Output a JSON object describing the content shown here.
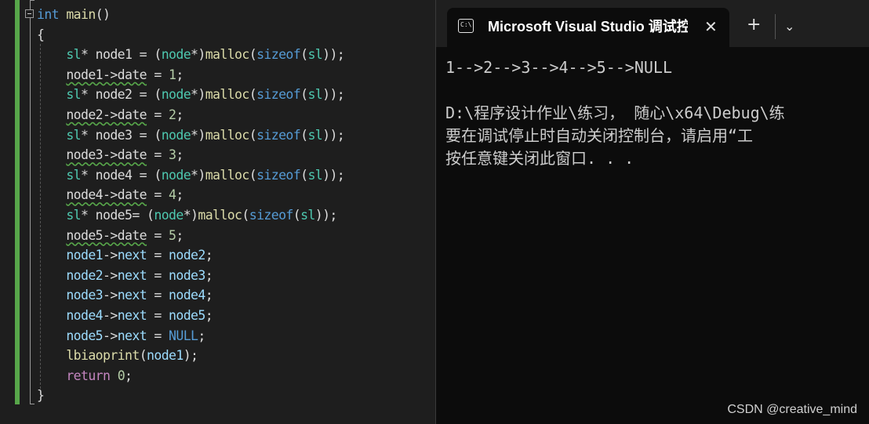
{
  "editor": {
    "lines": [
      {
        "parts": [
          [
            "int",
            "k"
          ],
          [
            " main",
            "f"
          ],
          [
            "()",
            ""
          ]
        ]
      },
      {
        "parts": [
          [
            "{",
            ""
          ]
        ]
      },
      {
        "parts": [
          [
            "    ",
            ""
          ],
          [
            "sl",
            "t"
          ],
          [
            "* node1 = (",
            ""
          ],
          [
            "node",
            "t"
          ],
          [
            "*)",
            ""
          ],
          [
            "malloc",
            "f"
          ],
          [
            "(",
            ""
          ],
          [
            "sizeof",
            "k"
          ],
          [
            "(",
            ""
          ],
          [
            "sl",
            "t"
          ],
          [
            "));",
            ""
          ]
        ]
      },
      {
        "parts": [
          [
            "    ",
            ""
          ],
          [
            "node1->date",
            "w"
          ],
          [
            " = ",
            ""
          ],
          [
            "1",
            "n"
          ],
          [
            ";",
            ""
          ]
        ]
      },
      {
        "parts": [
          [
            "    ",
            ""
          ],
          [
            "sl",
            "t"
          ],
          [
            "* node2 = (",
            ""
          ],
          [
            "node",
            "t"
          ],
          [
            "*)",
            ""
          ],
          [
            "malloc",
            "f"
          ],
          [
            "(",
            ""
          ],
          [
            "sizeof",
            "k"
          ],
          [
            "(",
            ""
          ],
          [
            "sl",
            "t"
          ],
          [
            "));",
            ""
          ]
        ]
      },
      {
        "parts": [
          [
            "    ",
            ""
          ],
          [
            "node2->date",
            "w"
          ],
          [
            " = ",
            ""
          ],
          [
            "2",
            "n"
          ],
          [
            ";",
            ""
          ]
        ]
      },
      {
        "parts": [
          [
            "    ",
            ""
          ],
          [
            "sl",
            "t"
          ],
          [
            "* node3 = (",
            ""
          ],
          [
            "node",
            "t"
          ],
          [
            "*)",
            ""
          ],
          [
            "malloc",
            "f"
          ],
          [
            "(",
            ""
          ],
          [
            "sizeof",
            "k"
          ],
          [
            "(",
            ""
          ],
          [
            "sl",
            "t"
          ],
          [
            "));",
            ""
          ]
        ]
      },
      {
        "parts": [
          [
            "    ",
            ""
          ],
          [
            "node3->date",
            "w"
          ],
          [
            " = ",
            ""
          ],
          [
            "3",
            "n"
          ],
          [
            ";",
            ""
          ]
        ]
      },
      {
        "parts": [
          [
            "    ",
            ""
          ],
          [
            "sl",
            "t"
          ],
          [
            "* node4 = (",
            ""
          ],
          [
            "node",
            "t"
          ],
          [
            "*)",
            ""
          ],
          [
            "malloc",
            "f"
          ],
          [
            "(",
            ""
          ],
          [
            "sizeof",
            "k"
          ],
          [
            "(",
            ""
          ],
          [
            "sl",
            "t"
          ],
          [
            "));",
            ""
          ]
        ]
      },
      {
        "parts": [
          [
            "    ",
            ""
          ],
          [
            "node4->date",
            "w"
          ],
          [
            " = ",
            ""
          ],
          [
            "4",
            "n"
          ],
          [
            ";",
            ""
          ]
        ]
      },
      {
        "parts": [
          [
            "    ",
            ""
          ],
          [
            "sl",
            "t"
          ],
          [
            "* node5= (",
            ""
          ],
          [
            "node",
            "t"
          ],
          [
            "*)",
            ""
          ],
          [
            "malloc",
            "f"
          ],
          [
            "(",
            ""
          ],
          [
            "sizeof",
            "k"
          ],
          [
            "(",
            ""
          ],
          [
            "sl",
            "t"
          ],
          [
            "));",
            ""
          ]
        ]
      },
      {
        "parts": [
          [
            "    ",
            ""
          ],
          [
            "node5->date",
            "w"
          ],
          [
            " = ",
            ""
          ],
          [
            "5",
            "n"
          ],
          [
            ";",
            ""
          ]
        ]
      },
      {
        "parts": [
          [
            "    ",
            ""
          ],
          [
            "node1",
            "v"
          ],
          [
            "->",
            ""
          ],
          [
            "next",
            "m"
          ],
          [
            " = ",
            ""
          ],
          [
            "node2",
            "v"
          ],
          [
            ";",
            ""
          ]
        ]
      },
      {
        "parts": [
          [
            "    ",
            ""
          ],
          [
            "node2",
            "v"
          ],
          [
            "->",
            ""
          ],
          [
            "next",
            "m"
          ],
          [
            " = ",
            ""
          ],
          [
            "node3",
            "v"
          ],
          [
            ";",
            ""
          ]
        ]
      },
      {
        "parts": [
          [
            "    ",
            ""
          ],
          [
            "node3",
            "v"
          ],
          [
            "->",
            ""
          ],
          [
            "next",
            "m"
          ],
          [
            " = ",
            ""
          ],
          [
            "node4",
            "v"
          ],
          [
            ";",
            ""
          ]
        ]
      },
      {
        "parts": [
          [
            "    ",
            ""
          ],
          [
            "node4",
            "v"
          ],
          [
            "->",
            ""
          ],
          [
            "next",
            "m"
          ],
          [
            " = ",
            ""
          ],
          [
            "node5",
            "v"
          ],
          [
            ";",
            ""
          ]
        ]
      },
      {
        "parts": [
          [
            "    ",
            ""
          ],
          [
            "node5",
            "v"
          ],
          [
            "->",
            ""
          ],
          [
            "next",
            "m"
          ],
          [
            " = ",
            ""
          ],
          [
            "NULL",
            "k"
          ],
          [
            ";",
            ""
          ]
        ]
      },
      {
        "parts": [
          [
            "    ",
            ""
          ],
          [
            "lbiaoprint",
            "f"
          ],
          [
            "(",
            ""
          ],
          [
            "node1",
            "v"
          ],
          [
            ");",
            ""
          ]
        ]
      },
      {
        "parts": [
          [
            "    ",
            ""
          ],
          [
            "return",
            "ret"
          ],
          [
            " ",
            ""
          ],
          [
            "0",
            "n"
          ],
          [
            ";",
            ""
          ]
        ]
      },
      {
        "parts": [
          [
            "}",
            ""
          ]
        ]
      }
    ]
  },
  "terminal": {
    "tab_title": "Microsoft Visual Studio 调试控制台",
    "tab_icon_text": "C:\\",
    "close_glyph": "✕",
    "new_tab_glyph": "+",
    "dropdown_glyph": "⌄",
    "output_lines": [
      "1-->2-->3-->4-->5-->NULL",
      "",
      "D:\\程序设计作业\\练习， 随心\\x64\\Debug\\练",
      "要在调试停止时自动关闭控制台，请启用“工",
      "按任意键关闭此窗口. . ."
    ]
  },
  "watermark": "CSDN @creative_mind"
}
